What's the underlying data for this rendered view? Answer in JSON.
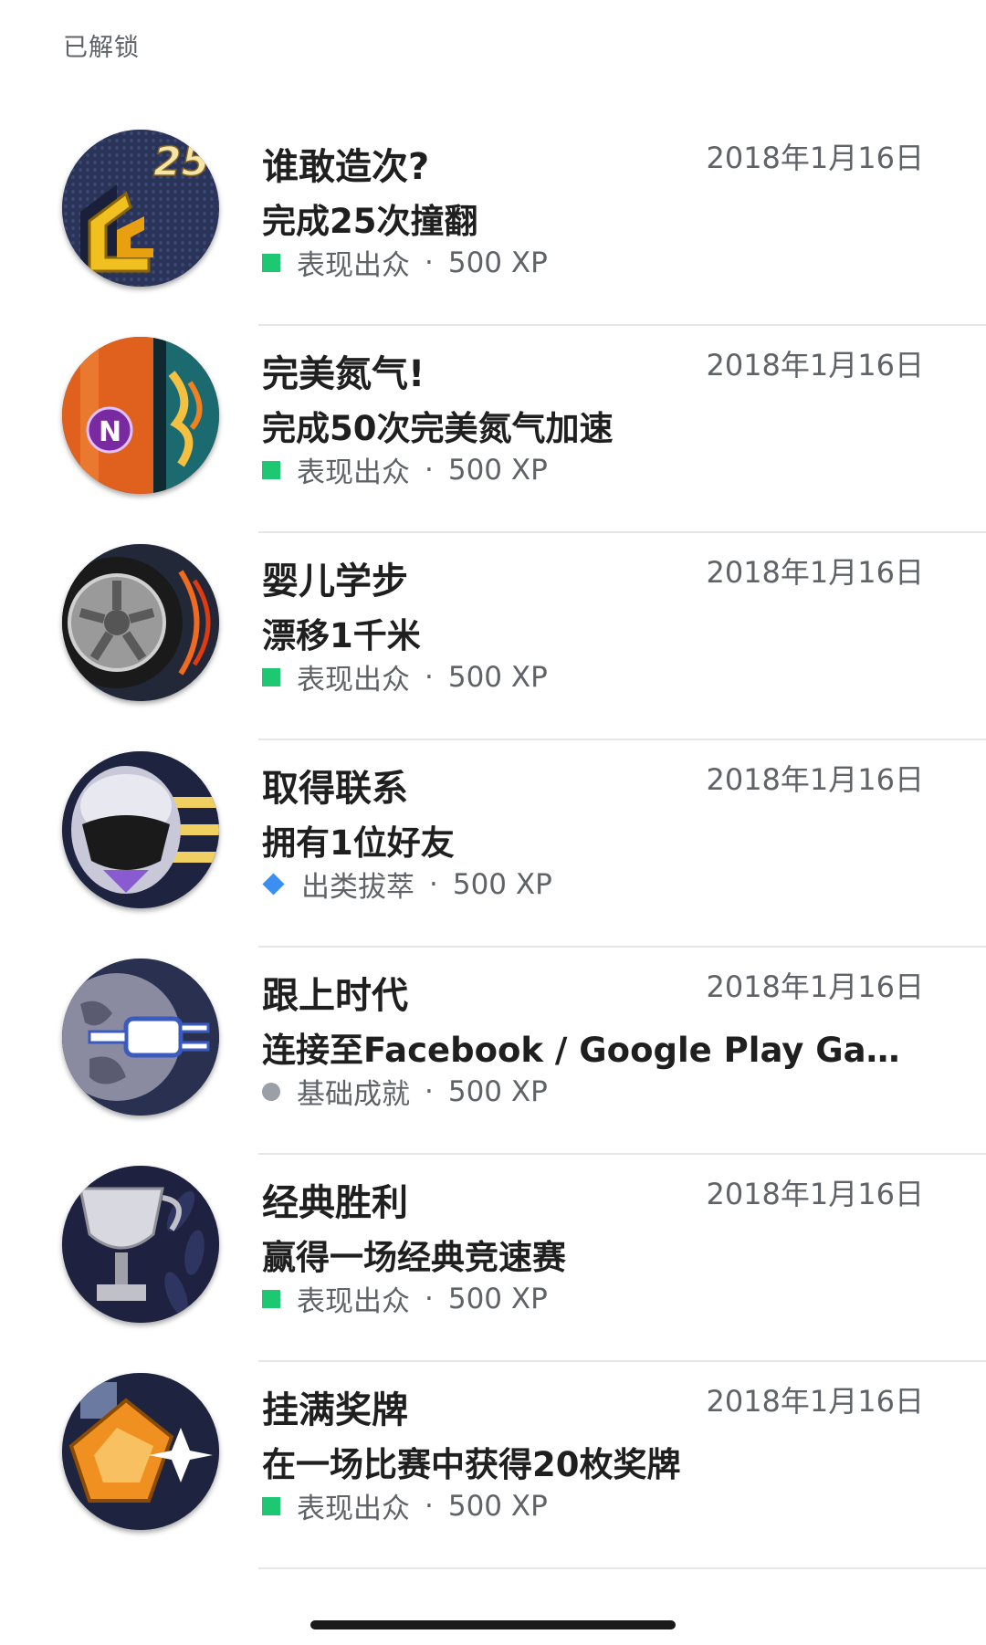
{
  "section_header": "已解锁",
  "achievements": [
    {
      "title": "谁敢造次?",
      "date": "2018年1月16日",
      "description": "完成25次撞翻",
      "rarity": "表现出众",
      "rarity_icon": "square",
      "rarity_color": "#1ec872",
      "separator": "·",
      "xp": "500 XP",
      "badge": {
        "icon": "crash-badge-icon",
        "label": "25"
      }
    },
    {
      "title": "完美氮气!",
      "date": "2018年1月16日",
      "description": "完成50次完美氮气加速",
      "rarity": "表现出众",
      "rarity_icon": "square",
      "rarity_color": "#1ec872",
      "separator": "·",
      "xp": "500 XP",
      "badge": {
        "icon": "nitro-badge-icon",
        "label": "N"
      }
    },
    {
      "title": "婴儿学步",
      "date": "2018年1月16日",
      "description": "漂移1千米",
      "rarity": "表现出众",
      "rarity_icon": "square",
      "rarity_color": "#1ec872",
      "separator": "·",
      "xp": "500 XP",
      "badge": {
        "icon": "tire-badge-icon"
      }
    },
    {
      "title": "取得联系",
      "date": "2018年1月16日",
      "description": "拥有1位好友",
      "rarity": "出类拔萃",
      "rarity_icon": "diamond",
      "rarity_color": "#3b8ff0",
      "separator": "·",
      "xp": "500 XP",
      "badge": {
        "icon": "helmet-badge-icon"
      }
    },
    {
      "title": "跟上时代",
      "date": "2018年1月16日",
      "description": "连接至Facebook / Google Play Ga...",
      "rarity": "基础成就",
      "rarity_icon": "circle",
      "rarity_color": "#9aa0a6",
      "separator": "·",
      "xp": "500 XP",
      "badge": {
        "icon": "globe-plug-badge-icon"
      }
    },
    {
      "title": "经典胜利",
      "date": "2018年1月16日",
      "description": "赢得一场经典竞速赛",
      "rarity": "表现出众",
      "rarity_icon": "square",
      "rarity_color": "#1ec872",
      "separator": "·",
      "xp": "500 XP",
      "badge": {
        "icon": "trophy-badge-icon"
      }
    },
    {
      "title": "挂满奖牌",
      "date": "2018年1月16日",
      "description": "在一场比赛中获得20枚奖牌",
      "rarity": "表现出众",
      "rarity_icon": "square",
      "rarity_color": "#1ec872",
      "separator": "·",
      "xp": "500 XP",
      "badge": {
        "icon": "medal-badge-icon"
      }
    }
  ]
}
